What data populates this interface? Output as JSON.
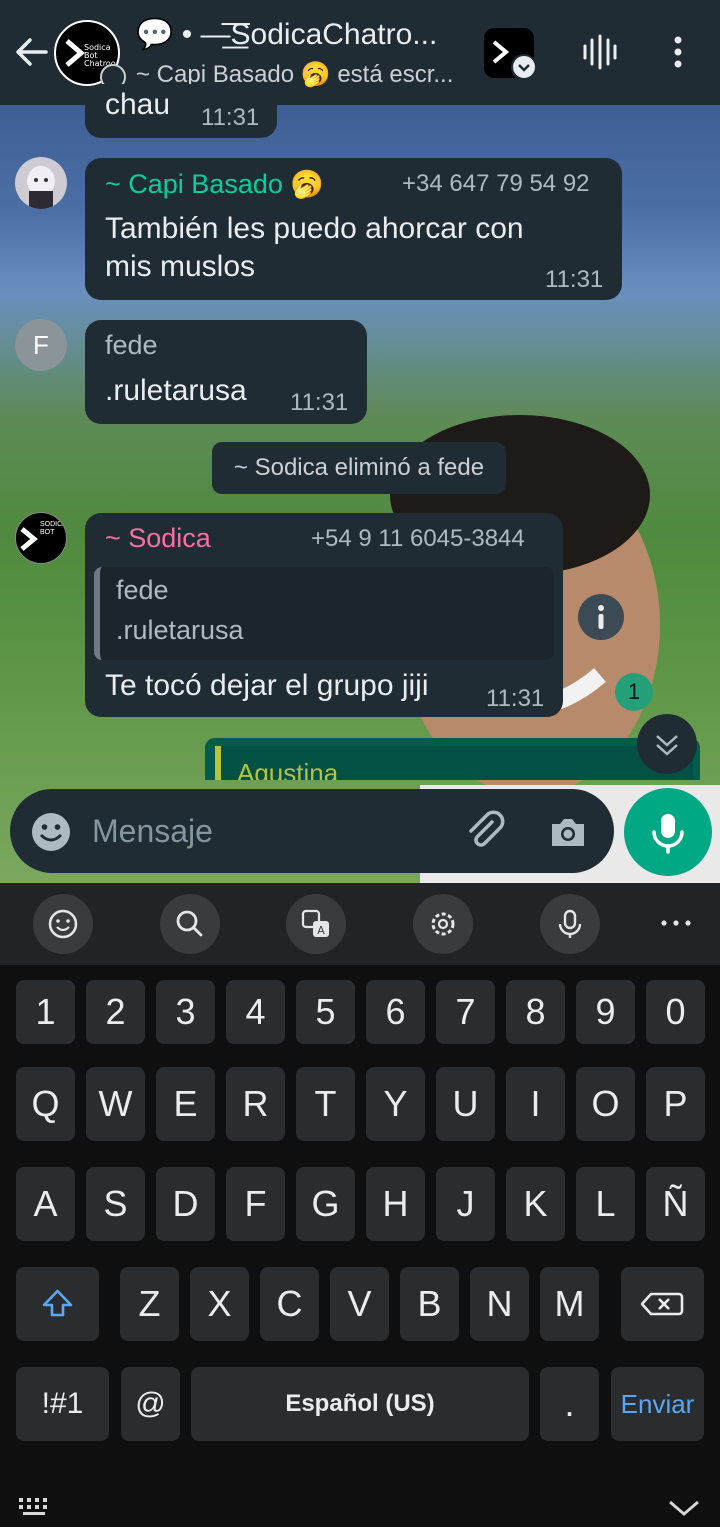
{
  "header": {
    "title": "💬 • —͟͞͞SodicaChatro...",
    "subtitle": "~ Capi Basado 🥱 está escr...",
    "avatar_text": "Sodica Bot Chatroom"
  },
  "messages": {
    "prev_fragment": {
      "text": "chau",
      "time": "11:31"
    },
    "capi": {
      "name": "~ Capi Basado 🥱",
      "phone": "+34 647 79 54 92",
      "line1": "También les puedo ahorcar con",
      "line2": "mis muslos",
      "time": "11:31"
    },
    "fede": {
      "avatar_letter": "F",
      "name": "fede",
      "text": ".ruletarusa",
      "time": "11:31"
    },
    "system": "~ Sodica eliminó a fede",
    "sodica": {
      "avatar_text": "SODICA BOT",
      "name": "~ Sodica",
      "phone": "+54 9 11 6045-3844",
      "quote_name": "fede",
      "quote_text": ".ruletarusa",
      "text": "Te tocó dejar el grupo jiji",
      "time": "11:31"
    },
    "outgoing_quote_name": "Agustina",
    "unread_count": "1"
  },
  "input": {
    "placeholder": "Mensaje"
  },
  "keyboard": {
    "numbers": [
      "1",
      "2",
      "3",
      "4",
      "5",
      "6",
      "7",
      "8",
      "9",
      "0"
    ],
    "row1": [
      "Q",
      "W",
      "E",
      "R",
      "T",
      "Y",
      "U",
      "I",
      "O",
      "P"
    ],
    "row2": [
      "A",
      "S",
      "D",
      "F",
      "G",
      "H",
      "J",
      "K",
      "L",
      "Ñ"
    ],
    "row3": [
      "Z",
      "X",
      "C",
      "V",
      "B",
      "N",
      "M"
    ],
    "sym": "!#1",
    "at": "@",
    "space": "Español (US)",
    "period": ".",
    "enter": "Enviar"
  },
  "colors": {
    "header_bg": "#1f2c34",
    "bubble_bg": "#1f2c34",
    "capi_name": "#06cf9c",
    "sodica_name": "#fc6fa0",
    "mic_green": "#00a884",
    "enviar_blue": "#5aa7f5"
  }
}
